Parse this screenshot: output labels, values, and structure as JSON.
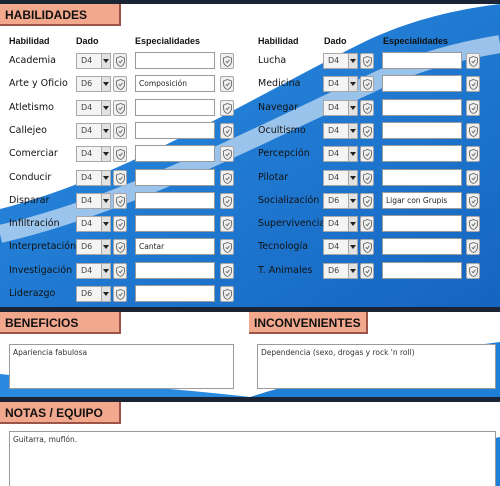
{
  "habilidades": {
    "title": "HABILIDADES",
    "col_skill": "Habilidad",
    "col_die": "Dado",
    "col_spec": "Especialidades",
    "left": [
      {
        "name": "Academia",
        "die": "D4",
        "spec": ""
      },
      {
        "name": "Arte y Oficio",
        "die": "D6",
        "spec": "Composición"
      },
      {
        "name": "Atletismo",
        "die": "D4",
        "spec": ""
      },
      {
        "name": "Callejeo",
        "die": "D4",
        "spec": ""
      },
      {
        "name": "Comerciar",
        "die": "D4",
        "spec": ""
      },
      {
        "name": "Conducir",
        "die": "D4",
        "spec": ""
      },
      {
        "name": "Disparar",
        "die": "D4",
        "spec": ""
      },
      {
        "name": "Infiltración",
        "die": "D4",
        "spec": ""
      },
      {
        "name": "Interpretación",
        "die": "D6",
        "spec": "Cantar"
      },
      {
        "name": "Investigación",
        "die": "D4",
        "spec": ""
      },
      {
        "name": "Liderazgo",
        "die": "D6",
        "spec": ""
      }
    ],
    "right": [
      {
        "name": "Lucha",
        "die": "D4",
        "spec": ""
      },
      {
        "name": "Medicina",
        "die": "D4",
        "spec": ""
      },
      {
        "name": "Navegar",
        "die": "D4",
        "spec": ""
      },
      {
        "name": "Ocultismo",
        "die": "D4",
        "spec": ""
      },
      {
        "name": "Percepción",
        "die": "D4",
        "spec": ""
      },
      {
        "name": "Pilotar",
        "die": "D4",
        "spec": ""
      },
      {
        "name": "Socialización",
        "die": "D6",
        "spec": "Ligar con Grupis"
      },
      {
        "name": "Supervivencia",
        "die": "D4",
        "spec": ""
      },
      {
        "name": "Tecnología",
        "die": "D4",
        "spec": ""
      },
      {
        "name": "T. Animales",
        "die": "D6",
        "spec": ""
      }
    ]
  },
  "beneficios": {
    "title": "BENEFICIOS",
    "text": "Apariencia fabulosa"
  },
  "inconvenientes": {
    "title": "INCONVENIENTES",
    "text": "Dependencia (sexo, drogas y rock 'n roll)"
  },
  "notas": {
    "title": "NOTAS / EQUIPO",
    "text": "Guitarra, muflón."
  },
  "colors": {
    "header_bg": "#f2a88d",
    "accent_blue": "#1e7fd6",
    "border": "#1b2434"
  }
}
